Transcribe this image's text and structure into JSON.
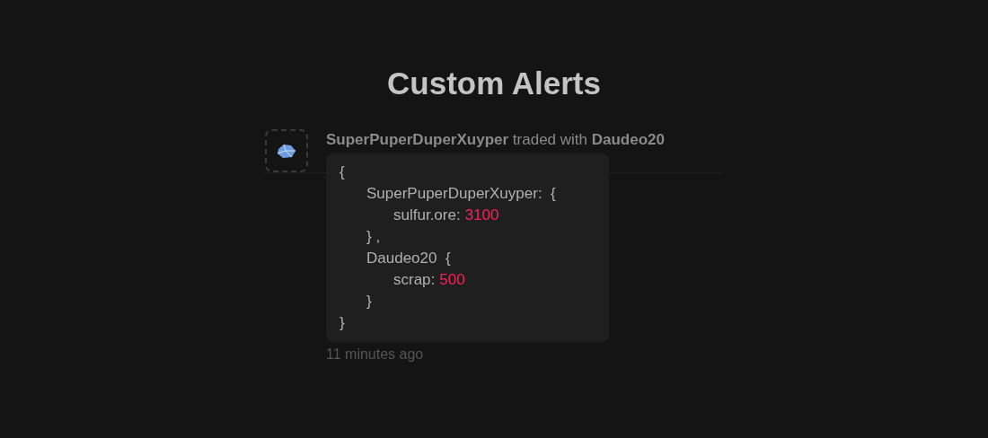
{
  "title": "Custom Alerts",
  "alert": {
    "message": "**SuperPuperDuperXuyper** traded with **Daudeo20**",
    "code": [
      {
        "text": "{",
        "children": [
          {
            "text": "SuperPuperDuperXuyper:  {",
            "children": [
              {
                "text": "sulfur.ore:",
                "value": "3100"
              }
            ]
          },
          {
            "text": "} ,"
          },
          {
            "text": "Daudeo20  {",
            "children": [
              {
                "text": "scrap:",
                "value": "500"
              }
            ]
          },
          {
            "text": "}"
          }
        ]
      },
      {
        "text": "}"
      }
    ],
    "time": "11 minutes ago"
  }
}
